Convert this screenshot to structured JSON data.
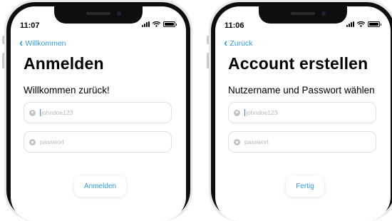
{
  "screens": [
    {
      "status_time": "11:07",
      "back_label": "Willkommen",
      "title": "Anmelden",
      "subtitle": "Willkommen zurück!",
      "username_placeholder": "johndoe123",
      "password_placeholder": "passwort",
      "button_label": "Anmelden"
    },
    {
      "status_time": "11:06",
      "back_label": "Zurück",
      "title": "Account erstellen",
      "subtitle": "Nutzername und Passwort wählen",
      "username_placeholder": "johndoe123",
      "password_placeholder": "passwort",
      "button_label": "Fertig"
    }
  ],
  "colors": {
    "accent": "#2f9be6",
    "field_border": "#e1e1e1",
    "placeholder": "#b8b8b8"
  },
  "icons": [
    "chevron-left-icon",
    "user-icon",
    "lock-icon",
    "wifi-icon",
    "signal-icon",
    "battery-icon"
  ]
}
